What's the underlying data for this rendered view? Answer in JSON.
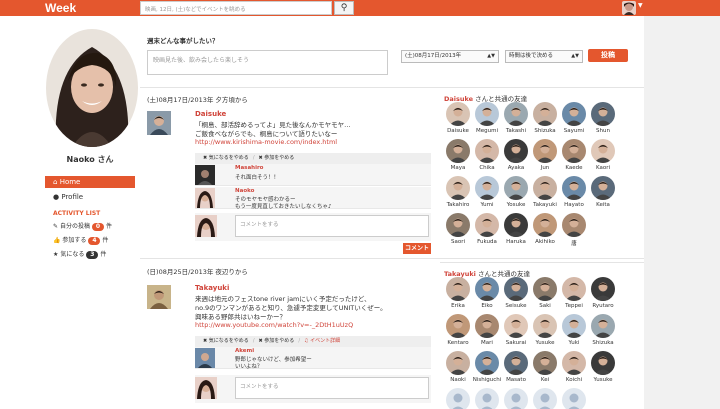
{
  "header": {
    "logo": "Week",
    "search_placeholder": "映画, 12日, (土)などでイベントを眺める",
    "search_icon": "search-icon"
  },
  "sidebar": {
    "profile_name": "Naoko さん",
    "nav": [
      {
        "label": "Home",
        "icon": "home-icon"
      },
      {
        "label": "Profile",
        "icon": "user-icon"
      }
    ],
    "activity_title": "ACTIVITY LIST",
    "activity": [
      {
        "label": "自分の投稿",
        "count": "0",
        "unit": "件",
        "icon": "pencil-icon",
        "color": "#e4572e"
      },
      {
        "label": "参加する",
        "count": "4",
        "unit": "件",
        "icon": "thumb-icon",
        "color": "#e4572e"
      },
      {
        "label": "気になる",
        "count": "3",
        "unit": "件",
        "icon": "star-icon",
        "color": "#333333"
      }
    ]
  },
  "composer": {
    "question": "週末どんな事がしたい？",
    "placeholder": "映画見た後、飲み会したら楽しそう",
    "date_value": "(土)08月17日/2013年",
    "time_value": "時間は後で決める",
    "post_label": "投稿"
  },
  "events": [
    {
      "date": "(土)08月17日/2013年 夕方頃から",
      "author": "Daisuke",
      "lines": [
        "「桐島、部活辞めるってよ」見た後なんかモヤモヤ…",
        "ご飯食べながらでも、桐島について語りたいなー"
      ],
      "link": "http://www.kirishima-movie.com/index.html",
      "actions": [
        "気になるをやめる",
        "参加をやめる"
      ],
      "comments": [
        {
          "name": "Masahiro",
          "lines": [
            "それ面白そう！！"
          ]
        },
        {
          "name": "Naoko",
          "lines": [
            "そのモヤモヤ感わかるー",
            "もう一度見直しておきたいしなくちゃ♪"
          ]
        }
      ],
      "comment_placeholder": "コメントをする",
      "comment_submit": "コメント"
    },
    {
      "date": "(日)08月25日/2013年 夜辺りから",
      "author": "Takayuki",
      "lines": [
        "来週は地元のフェスtone river jamにいく予定だったけど、",
        "no.9のワンマンがあると知り、急遽予定変更してUNITいくぜー。",
        "興味ある野郎共はいねーかー？"
      ],
      "link": "http://www.youtube.com/watch?v=-_2DtH1uUzQ",
      "actions": [
        "気になるをやめる",
        "参加をやめる",
        "イベント詳細"
      ],
      "comments": [
        {
          "name": "Akemi",
          "lines": [
            "野郎じゃないけど、参加希望ー",
            "いいよね？"
          ]
        }
      ],
      "comment_placeholder": "コメントをする"
    }
  ],
  "friends_panels": [
    {
      "owner": "Daisuke",
      "suffix": "さんと共通の友達",
      "friends": [
        "Daisuke",
        "Megumi",
        "Takashi",
        "Shizuka",
        "Sayumi",
        "Shun",
        "Maya",
        "Chika",
        "Ayaka",
        "Jun",
        "Kaede",
        "Kaori",
        "Takahiro",
        "Yumi",
        "Yosuke",
        "Takayuki",
        "Hayato",
        "Keita",
        "Saori",
        "Fukuda",
        "Haruka",
        "Akihiko",
        "唐"
      ]
    },
    {
      "owner": "Takayuki",
      "suffix": "さんと共通の友達",
      "friends": [
        "Erika",
        "Eiko",
        "Seisuke",
        "Saki",
        "Teppei",
        "Ryutaro",
        "Kentaro",
        "Mari",
        "Sakurai",
        "Yusuke",
        "Yuki",
        "Shizuka",
        "Naoki",
        "Nishiguchi",
        "Masato",
        "Kei",
        "Koichi",
        "Yusuke",
        "",
        "",
        "",
        "",
        ""
      ]
    }
  ]
}
